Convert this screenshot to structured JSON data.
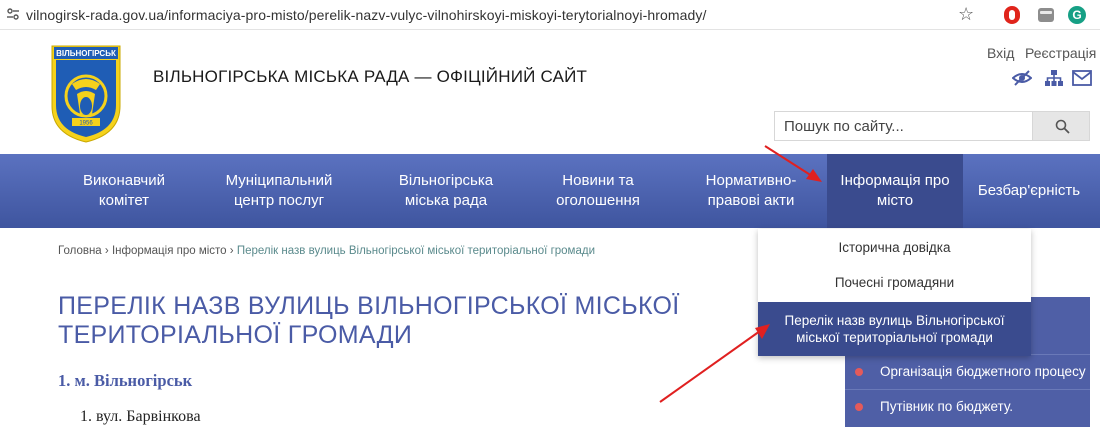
{
  "browser": {
    "url": "vilnogirsk-rada.gov.ua/informaciya-pro-misto/perelik-nazv-vulyc-vilnohirskoyi-miskoyi-terytorialnoyi-hromady/"
  },
  "header": {
    "logo_text": "ВІЛЬНОГІРСЬК",
    "logo_year": "1956",
    "site_title": "ВІЛЬНОГІРСЬКА МІСЬКА РАДА — ОФІЦІЙНИЙ САЙТ",
    "login": "Вхід",
    "register": "Реєстрація",
    "search_placeholder": "Пошук по сайту..."
  },
  "nav": {
    "items": [
      {
        "label": "Виконавчий комітет"
      },
      {
        "label": "Муніципальний центр послуг"
      },
      {
        "label": "Вільногірська міська рада"
      },
      {
        "label": "Новини та оголошення"
      },
      {
        "label": "Нормативно-правові акти"
      },
      {
        "label": "Інформація про місто",
        "active": true
      },
      {
        "label": "Безбар'єрність"
      }
    ]
  },
  "dropdown": {
    "items": [
      {
        "label": "Історична довідка"
      },
      {
        "label": "Почесні громадяни"
      },
      {
        "label": "Перелік назв вулиць Вільногірської міської територіальної громади",
        "active": true
      }
    ]
  },
  "breadcrumb": {
    "home": "Головна",
    "separator": "›",
    "parent": "Інформація про місто",
    "current": "Перелік назв вулиць Вільногірської міської територіальної громади"
  },
  "content": {
    "title": "ПЕРЕЛІК НАЗВ ВУЛИЦЬ ВІЛЬНОГІРСЬКОЇ МІСЬКОЇ ТЕРИТОРІАЛЬНОЇ ГРОМАДИ",
    "section_heading": "1. м. Вільногірськ",
    "first_street": "1. вул. Барвінкова"
  },
  "sidebar": {
    "links": [
      {
        "label": "Організація бюджетного процесу"
      },
      {
        "label": "Путівник по бюджету."
      }
    ]
  },
  "colors": {
    "nav_bg": "#4a5fb0",
    "nav_active": "#3a4b8e",
    "title": "#4a5ba6",
    "annotation_arrow": "#e02020"
  }
}
